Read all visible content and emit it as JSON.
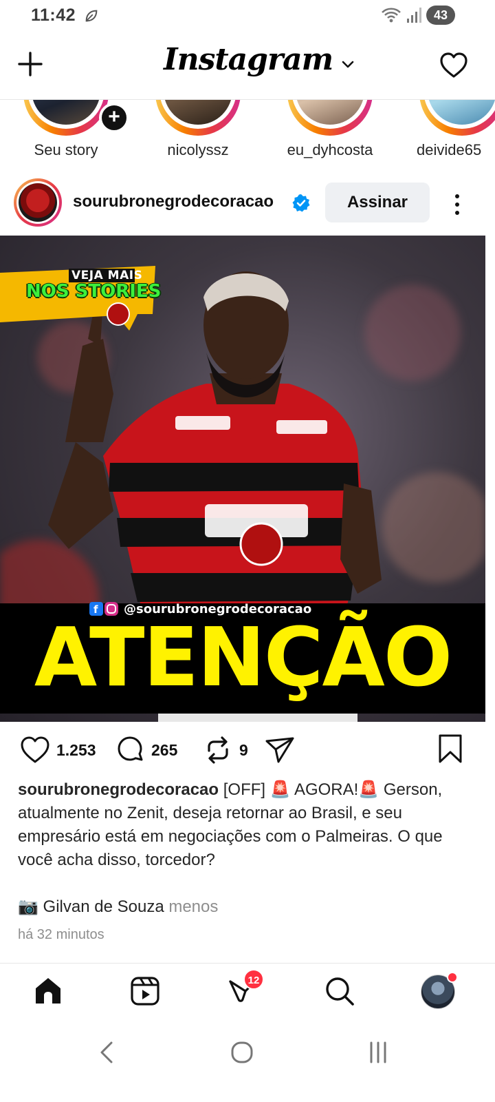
{
  "status_bar": {
    "time": "11:42",
    "battery": "43"
  },
  "header": {
    "logo": "Instagram"
  },
  "stories": [
    {
      "label": "Seu story"
    },
    {
      "label": "nicolyssz"
    },
    {
      "label": "eu_dyhcosta"
    },
    {
      "label": "deivide65"
    }
  ],
  "post": {
    "username": "sourubronegrodecoracao",
    "follow_label": "Assinar",
    "image": {
      "banner_line1": "VEJA MAIS",
      "banner_line2": "NOS STORIES",
      "handle": "@sourubronegrodecoracao",
      "headline": "ATENÇÃO"
    },
    "likes": "1.253",
    "comments": "265",
    "reposts": "9",
    "caption_user": "sourubronegrodecoracao",
    "caption_text": " [OFF] 🚨 AGORA!🚨 Gerson, atualmente no Zenit, deseja retornar ao Brasil, e seu empresário está em negociações com o Palmeiras. O que você acha disso, torcedor?",
    "photo_credit": "📷 Gilvan de Souza",
    "less_label": "menos",
    "time_ago": "há 32 minutos"
  },
  "bottom_nav": {
    "activity_badge": "12"
  },
  "colors": {
    "accent": "#0095f6",
    "badge": "#ff3040",
    "headline_yellow": "#fff200",
    "banner_green": "#3cf03c"
  }
}
